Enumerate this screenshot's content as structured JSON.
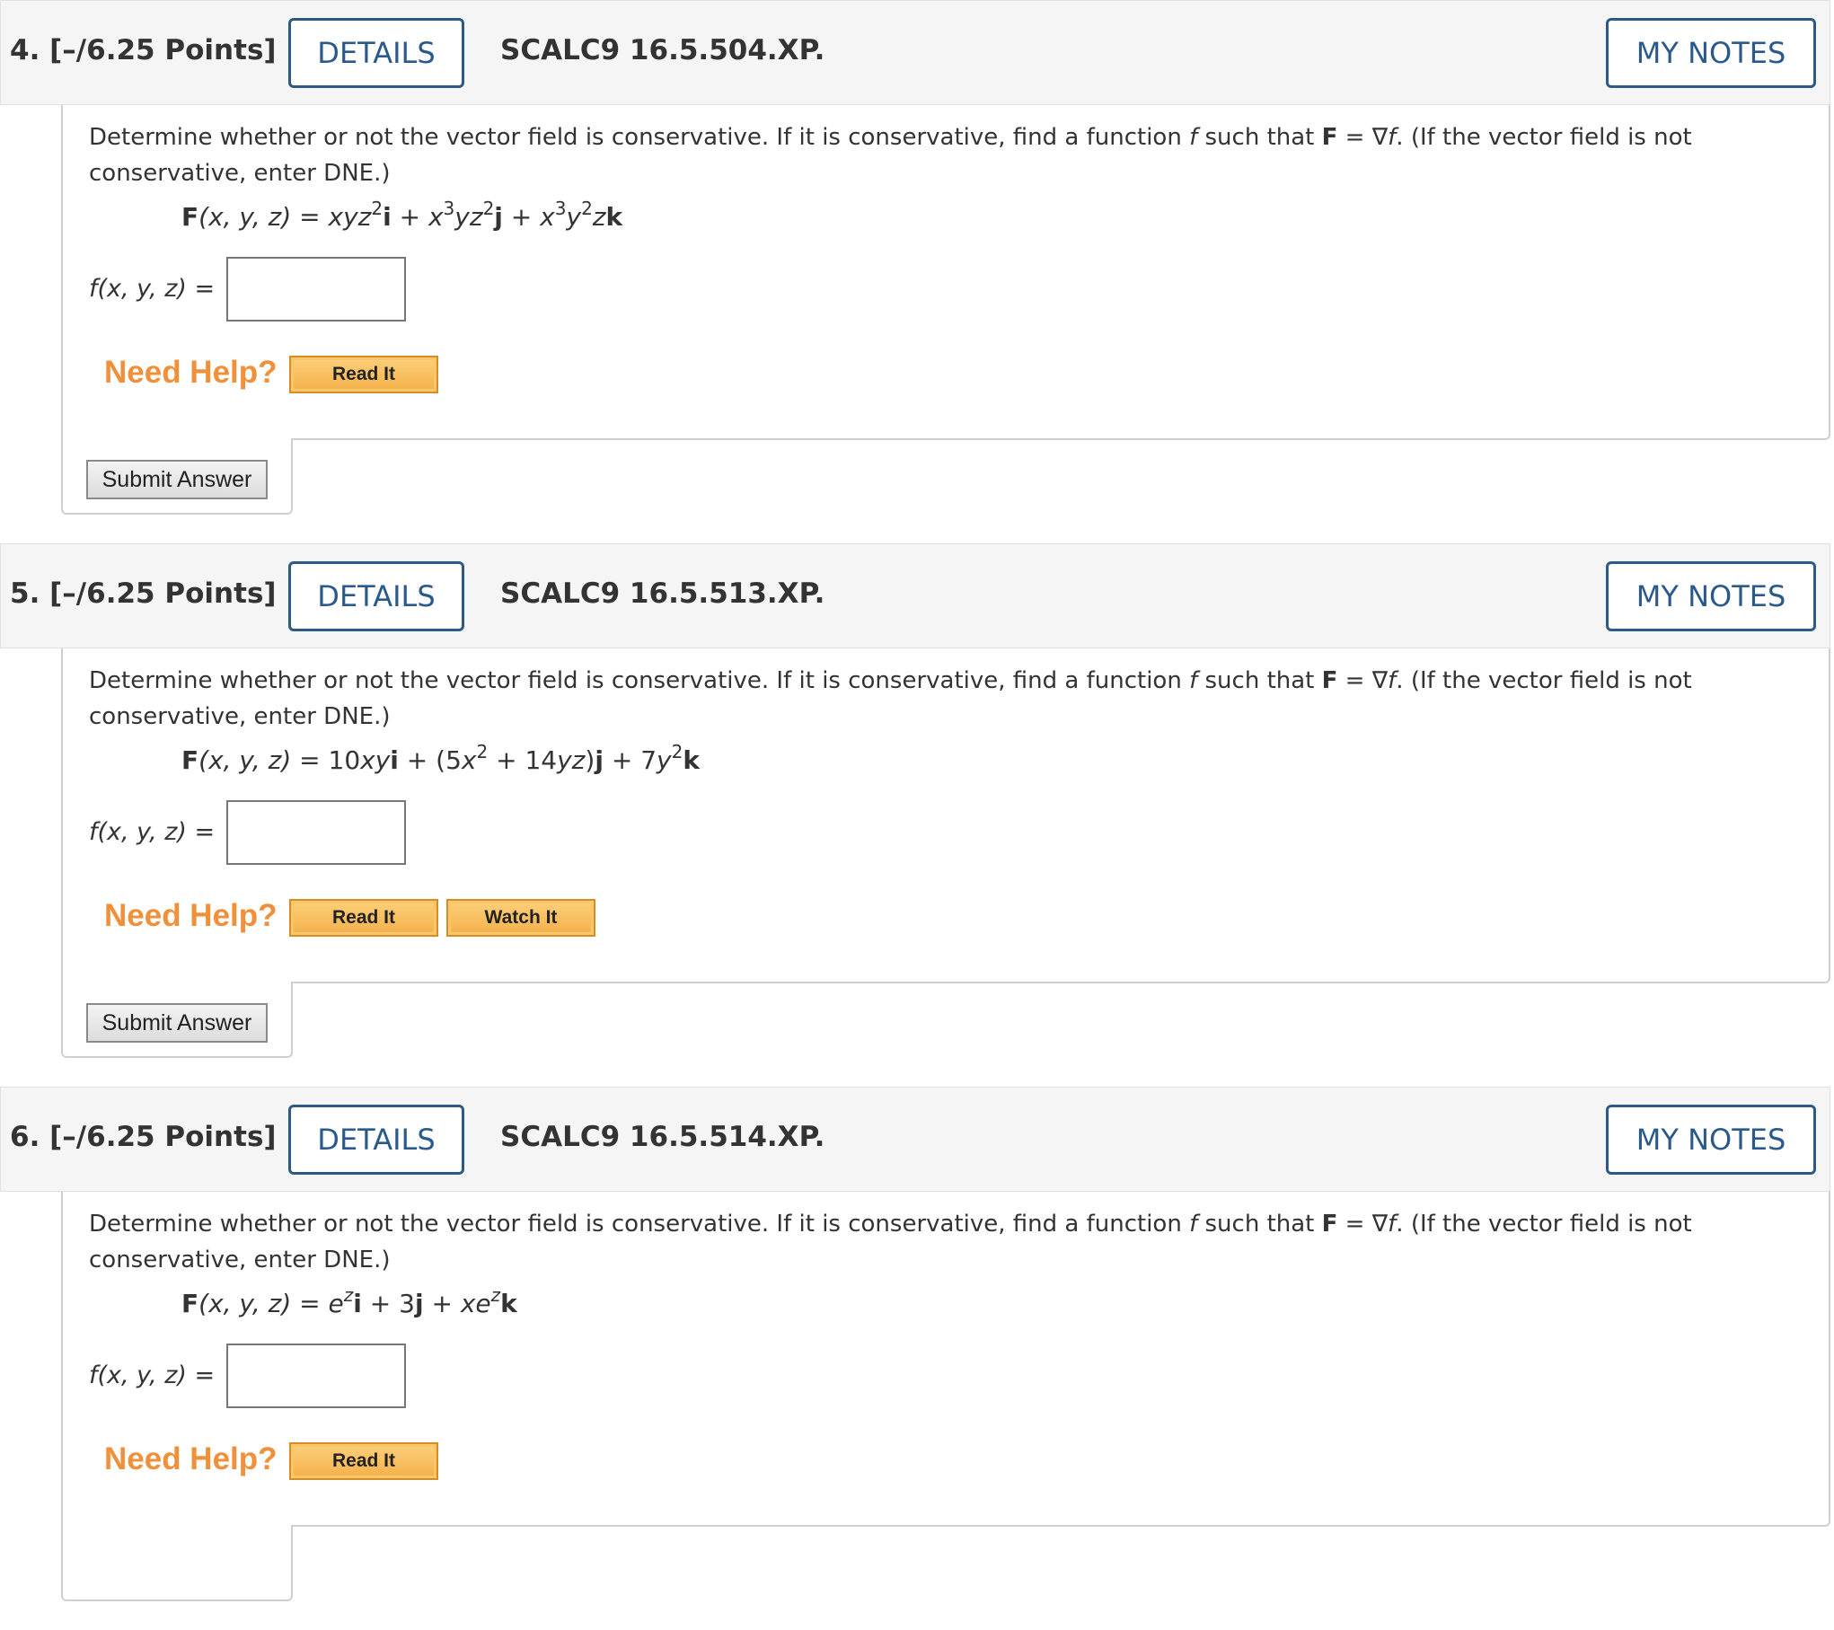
{
  "questions": [
    {
      "points": "4. [–/6.25 Points]",
      "details_label": "DETAILS",
      "code": "SCALC9 16.5.504.XP.",
      "notes_label": "MY NOTES",
      "prompt_1": "Determine whether or not the vector field is conservative. If it is conservative, find a function ",
      "prompt_f": "f",
      "prompt_2": " such that ",
      "prompt_F": "F",
      "prompt_3": " = ∇",
      "prompt_f2": "f",
      "prompt_4": ". (If the vector field is not conservative, enter DNE.)",
      "formula": {
        "lhs_bold": "F",
        "lhs": "(x, y, z) = ",
        "t1": "xyz",
        "t1_sup": "2",
        "t1_unit": "i",
        "plus1": " + ",
        "t2a": "x",
        "t2a_sup": "3",
        "t2b": "yz",
        "t2b_sup": "2",
        "t2_unit": "j",
        "plus2": " + ",
        "t3a": "x",
        "t3a_sup": "3",
        "t3b": "y",
        "t3b_sup": "2",
        "t3c": "z",
        "t3_unit": "k"
      },
      "answer_label": "f(x, y, z) =",
      "answer_value": "",
      "need_help": "Need Help?",
      "read_it": "Read It",
      "submit": "Submit Answer"
    },
    {
      "points": "5. [–/6.25 Points]",
      "details_label": "DETAILS",
      "code": "SCALC9 16.5.513.XP.",
      "notes_label": "MY NOTES",
      "prompt_1": "Determine whether or not the vector field is conservative. If it is conservative, find a function ",
      "prompt_f": "f",
      "prompt_2": " such that ",
      "prompt_F": "F",
      "prompt_3": " = ∇",
      "prompt_f2": "f",
      "prompt_4": ". (If the vector field is not conservative, enter DNE.)",
      "formula": {
        "lhs_bold": "F",
        "lhs": "(x, y, z) = ",
        "t1a": "10",
        "t1b": "xy",
        "t1_unit": "i",
        "plus1": " + (5",
        "t2a": "x",
        "t2a_sup": "2",
        "t2b": " + 14",
        "t2c": "yz",
        "t2d": ")",
        "t2_unit": "j",
        "plus2": " + 7",
        "t3a": "y",
        "t3a_sup": "2",
        "t3_unit": "k"
      },
      "answer_label": "f(x, y, z) =",
      "answer_value": "",
      "need_help": "Need Help?",
      "read_it": "Read It",
      "watch_it": "Watch It",
      "submit": "Submit Answer"
    },
    {
      "points": "6. [–/6.25 Points]",
      "details_label": "DETAILS",
      "code": "SCALC9 16.5.514.XP.",
      "notes_label": "MY NOTES",
      "prompt_1": "Determine whether or not the vector field is conservative. If it is conservative, find a function ",
      "prompt_f": "f",
      "prompt_2": " such that ",
      "prompt_F": "F",
      "prompt_3": " = ∇",
      "prompt_f2": "f",
      "prompt_4": ". (If the vector field is not conservative, enter DNE.)",
      "formula": {
        "lhs_bold": "F",
        "lhs": "(x, y, z) = ",
        "t1a": "e",
        "t1a_sup": "z",
        "t1_unit": "i",
        "plus1": " + 3",
        "t2_unit": "j",
        "plus2": " + ",
        "t3a": "xe",
        "t3a_sup": "z",
        "t3_unit": "k"
      },
      "answer_label": "f(x, y, z) =",
      "answer_value": "",
      "need_help": "Need Help?",
      "read_it": "Read It"
    }
  ]
}
